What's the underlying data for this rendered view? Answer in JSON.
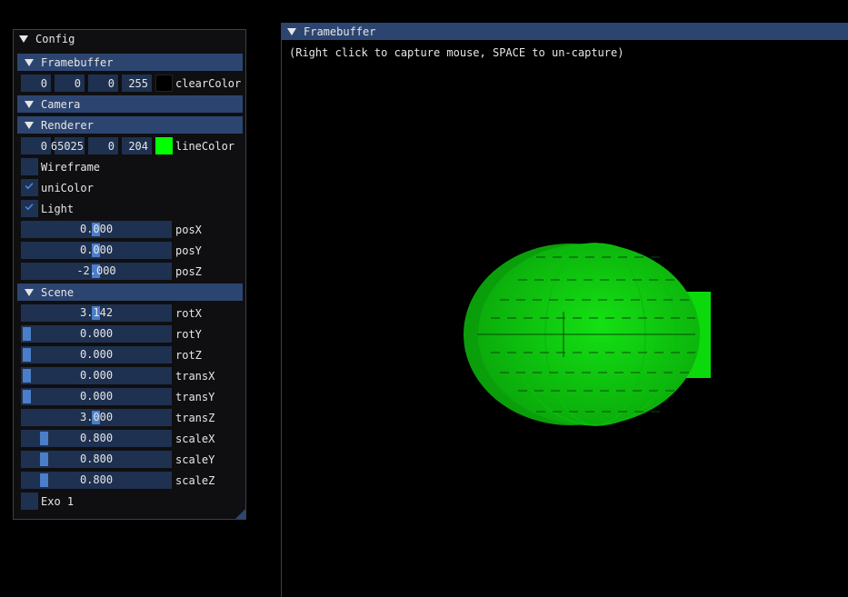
{
  "config": {
    "title": "Config",
    "framebuffer_header": "Framebuffer",
    "clear_color": {
      "r": "0",
      "g": "0",
      "b": "0",
      "a": "255",
      "label": "clearColor",
      "swatch": "#000000"
    },
    "camera_header": "Camera",
    "renderer_header": "Renderer",
    "line_color": {
      "r": "0",
      "g": "65025",
      "b": "0",
      "a": "204",
      "label": "lineColor",
      "swatch": "#00ff00"
    },
    "wireframe": {
      "label": "Wireframe",
      "checked": false
    },
    "unicolor": {
      "label": "uniColor",
      "checked": true
    },
    "light": {
      "label": "Light",
      "checked": true
    },
    "pos": [
      {
        "label": "posX",
        "value": "0.000"
      },
      {
        "label": "posY",
        "value": "0.000"
      },
      {
        "label": "posZ",
        "value": "-2.000"
      }
    ],
    "scene_header": "Scene",
    "scene": [
      {
        "label": "rotX",
        "value": "3.142"
      },
      {
        "label": "rotY",
        "value": "0.000"
      },
      {
        "label": "rotZ",
        "value": "0.000"
      },
      {
        "label": "transX",
        "value": "0.000"
      },
      {
        "label": "transY",
        "value": "0.000"
      },
      {
        "label": "transZ",
        "value": "3.000"
      },
      {
        "label": "scaleX",
        "value": "0.800"
      },
      {
        "label": "scaleY",
        "value": "0.800"
      },
      {
        "label": "scaleZ",
        "value": "0.800"
      }
    ],
    "exo": {
      "label": "Exo 1",
      "checked": false
    }
  },
  "framebuffer": {
    "title": "Framebuffer",
    "hint": "(Right click to capture mouse, SPACE to un-capture)"
  },
  "colors": {
    "header": "#2c4570",
    "frame": "#1f3150",
    "grab": "#4a7ec8",
    "mesh": "#00d000"
  }
}
